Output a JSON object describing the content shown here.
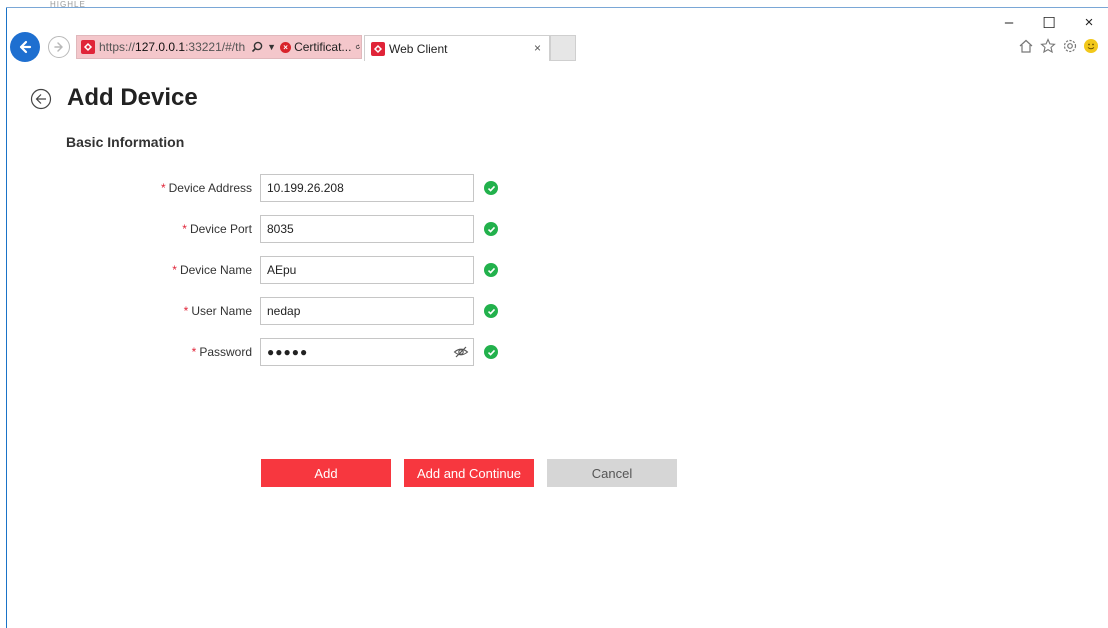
{
  "browser": {
    "top_strip": "HIGHLE",
    "address": {
      "scheme": "https://",
      "host": "127.0.0.1",
      "rest": ":33221/#/th",
      "cert_label": "Certificat..."
    },
    "tab": {
      "title": "Web Client",
      "close": "×"
    },
    "window": {
      "minimize": "–",
      "maximize": "☐",
      "close": "×"
    }
  },
  "page": {
    "title": "Add Device",
    "section": "Basic Information"
  },
  "form": {
    "required_mark": "*",
    "fields": [
      {
        "label": "Device Address",
        "value": "10.199.26.208"
      },
      {
        "label": "Device Port",
        "value": "8035"
      },
      {
        "label": "Device Name",
        "value": "AEpu"
      },
      {
        "label": "User Name",
        "value": "nedap"
      },
      {
        "label": "Password",
        "value": "●●●●●"
      }
    ]
  },
  "buttons": {
    "add": "Add",
    "add_continue": "Add and Continue",
    "cancel": "Cancel"
  },
  "colors": {
    "accent": "#f7373f",
    "valid": "#22b14c",
    "browser_blue": "#1e6fd0",
    "address_error": "#f4c7cb"
  }
}
